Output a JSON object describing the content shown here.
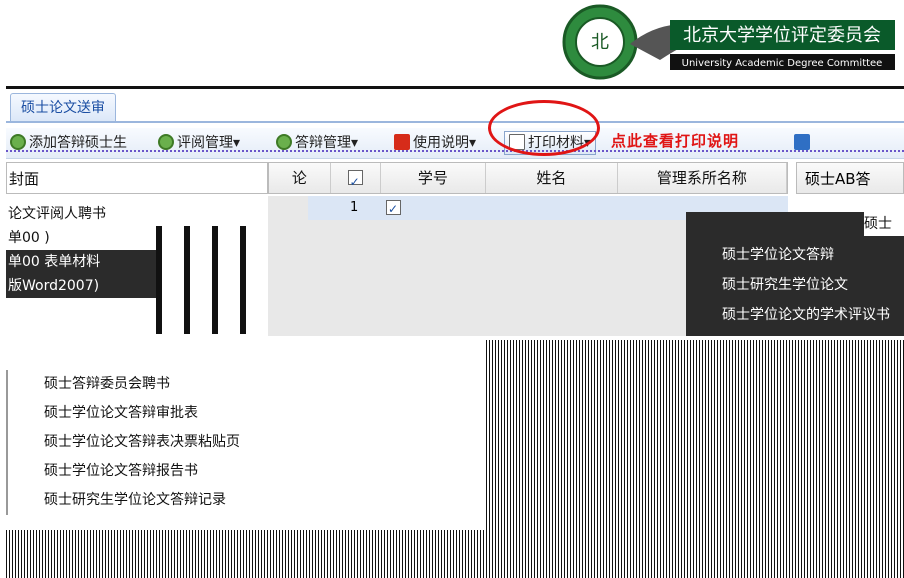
{
  "header": {
    "logo_label": "北京大学学位评定委员会",
    "logo_sublabel": "University Academic Degree Committee"
  },
  "tab": {
    "label": "硕士论文送审"
  },
  "toolbar": {
    "add_label": "添加答辩硕士生",
    "review_label": "评阅管理",
    "defense_label": "答辩管理",
    "usage_label": "使用说明",
    "print_label": "打印材料",
    "hint_label": "点此查看打印说明"
  },
  "left_menu": {
    "cover_label": "封面",
    "items": [
      {
        "label": "论文评阅人聘书",
        "dark": false
      },
      {
        "label": "单00 )",
        "dark": false
      },
      {
        "label": "单00 表单材料",
        "dark": true
      },
      {
        "label": "版Word2007)",
        "dark": true
      }
    ],
    "sub_items": [
      {
        "label": "硕士答辩委员会聘书"
      },
      {
        "label": "硕士学位论文答辩审批表"
      },
      {
        "label": "硕士学位论文答辩表决票粘贴页"
      },
      {
        "label": "硕士学位论文答辩报告书"
      },
      {
        "label": "硕士研究生学位论文答辩记录"
      }
    ]
  },
  "grid": {
    "columns": [
      {
        "label": "论"
      },
      {
        "label": ""
      },
      {
        "label": "学号"
      },
      {
        "label": "姓名"
      },
      {
        "label": "管理系所名称"
      }
    ],
    "rows": [
      {
        "num": "1",
        "checked": true
      }
    ]
  },
  "right_panel": {
    "header_label": "硕士AB答",
    "row1_label": "硕士",
    "dark_lines": [
      {
        "label": "硕士学位论文答辩"
      },
      {
        "label": "硕士研究生学位论文"
      },
      {
        "label": "硕士学位论文的学术评议书"
      }
    ]
  },
  "colors": {
    "accent": "#1a4ea3",
    "highlight_red": "#e01515",
    "row_selected": "#dbe6f5"
  }
}
